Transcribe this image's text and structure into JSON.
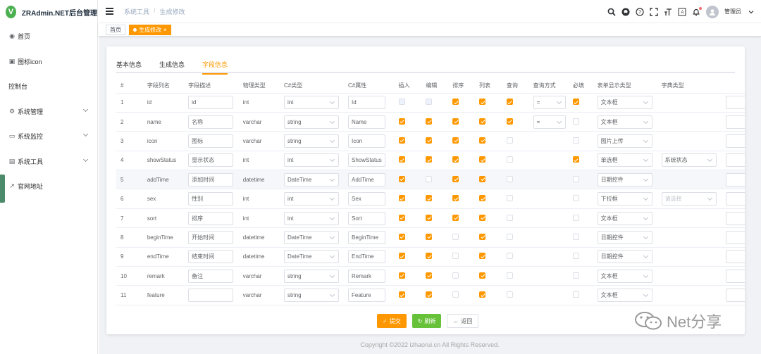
{
  "app": {
    "logo_letter": "V",
    "title": "ZRAdmin.NET后台管理"
  },
  "sidebar": {
    "items": [
      {
        "icon": "dashboard-icon",
        "glyph": "◉",
        "label": "首页",
        "has_arrow": false
      },
      {
        "icon": "image-icon",
        "glyph": "▣",
        "label": "图标icon",
        "has_arrow": false
      },
      {
        "icon": "",
        "glyph": "",
        "label": "控制台",
        "has_arrow": false
      },
      {
        "icon": "gear-icon",
        "glyph": "⚙",
        "label": "系统管理",
        "has_arrow": true
      },
      {
        "icon": "monitor-icon",
        "glyph": "▭",
        "label": "系统监控",
        "has_arrow": true
      },
      {
        "icon": "toolbox-icon",
        "glyph": "▤",
        "label": "系统工具",
        "has_arrow": true
      },
      {
        "icon": "external-link-icon",
        "glyph": "↗",
        "label": "官网地址",
        "has_arrow": false
      }
    ]
  },
  "navbar": {
    "breadcrumb": [
      "系统工具",
      "生成修改"
    ],
    "user_name": "管理员",
    "icons": [
      "search-icon",
      "github-icon",
      "help-icon",
      "fullscreen-icon",
      "font-size-icon",
      "translate-icon",
      "bell-icon"
    ]
  },
  "tags": [
    {
      "label": "首页",
      "active": false
    },
    {
      "label": "生成修改",
      "active": true
    }
  ],
  "tabs": [
    {
      "label": "基本信息",
      "active": false
    },
    {
      "label": "生成信息",
      "active": false
    },
    {
      "label": "字段信息",
      "active": true
    }
  ],
  "table": {
    "headers": [
      "#",
      "字段列名",
      "字段描述",
      "物理类型",
      "C#类型",
      "C#属性",
      "插入",
      "编辑",
      "排序",
      "列表",
      "查询",
      "查询方式",
      "必填",
      "表单显示类型",
      "字典类型",
      ""
    ],
    "rows": [
      {
        "no": "1",
        "column": "id",
        "desc": "id",
        "db_type": "int",
        "cs_type": "int",
        "cs_field": "Id",
        "insert": "dis",
        "edit": "dis",
        "sort": "on",
        "list": "on",
        "query": "on",
        "query_type": "=",
        "required": "on",
        "html_type": "文本框",
        "dict": "",
        "dict_ph": false
      },
      {
        "no": "2",
        "column": "name",
        "desc": "名称",
        "db_type": "varchar",
        "cs_type": "string",
        "cs_field": "Name",
        "insert": "on",
        "edit": "on",
        "sort": "on",
        "list": "on",
        "query": "on",
        "query_type": "=",
        "required": "off",
        "html_type": "文本框",
        "dict": "",
        "dict_ph": false
      },
      {
        "no": "3",
        "column": "icon",
        "desc": "图标",
        "db_type": "varchar",
        "cs_type": "string",
        "cs_field": "Icon",
        "insert": "on",
        "edit": "on",
        "sort": "on",
        "list": "on",
        "query": "off",
        "query_type": "",
        "required": "off",
        "html_type": "图片上传",
        "dict": "",
        "dict_ph": false
      },
      {
        "no": "4",
        "column": "showStatus",
        "desc": "显示状态",
        "db_type": "int",
        "cs_type": "int",
        "cs_field": "ShowStatus",
        "insert": "on",
        "edit": "on",
        "sort": "on",
        "list": "on",
        "query": "off",
        "query_type": "",
        "required": "on",
        "html_type": "单选框",
        "dict": "系统状态",
        "dict_ph": false
      },
      {
        "no": "5",
        "column": "addTime",
        "desc": "添加时间",
        "db_type": "datetime",
        "cs_type": "DateTime",
        "cs_field": "AddTime",
        "insert": "on",
        "edit": "off",
        "sort": "on",
        "list": "on",
        "query": "off",
        "query_type": "",
        "required": "off",
        "html_type": "日期控件",
        "dict": "",
        "dict_ph": false
      },
      {
        "no": "6",
        "column": "sex",
        "desc": "性别",
        "db_type": "int",
        "cs_type": "int",
        "cs_field": "Sex",
        "insert": "on",
        "edit": "on",
        "sort": "on",
        "list": "on",
        "query": "off",
        "query_type": "",
        "required": "off",
        "html_type": "下拉框",
        "dict": "请选择",
        "dict_ph": true
      },
      {
        "no": "7",
        "column": "sort",
        "desc": "排序",
        "db_type": "int",
        "cs_type": "int",
        "cs_field": "Sort",
        "insert": "on",
        "edit": "on",
        "sort": "on",
        "list": "on",
        "query": "off",
        "query_type": "",
        "required": "off",
        "html_type": "文本框",
        "dict": "",
        "dict_ph": false
      },
      {
        "no": "8",
        "column": "beginTime",
        "desc": "开始时间",
        "db_type": "datetime",
        "cs_type": "DateTime",
        "cs_field": "BeginTime",
        "insert": "on",
        "edit": "on",
        "sort": "off",
        "list": "on",
        "query": "off",
        "query_type": "",
        "required": "off",
        "html_type": "日期控件",
        "dict": "",
        "dict_ph": false
      },
      {
        "no": "9",
        "column": "endTime",
        "desc": "结束时间",
        "db_type": "datetime",
        "cs_type": "DateTime",
        "cs_field": "EndTime",
        "insert": "on",
        "edit": "on",
        "sort": "off",
        "list": "on",
        "query": "off",
        "query_type": "",
        "required": "off",
        "html_type": "日期控件",
        "dict": "",
        "dict_ph": false
      },
      {
        "no": "10",
        "column": "remark",
        "desc": "备注",
        "db_type": "varchar",
        "cs_type": "string",
        "cs_field": "Remark",
        "insert": "on",
        "edit": "on",
        "sort": "off",
        "list": "on",
        "query": "off",
        "query_type": "",
        "required": "off",
        "html_type": "文本框",
        "dict": "",
        "dict_ph": false
      },
      {
        "no": "11",
        "column": "feature",
        "desc": "",
        "db_type": "varchar",
        "cs_type": "string",
        "cs_field": "Feature",
        "insert": "on",
        "edit": "on",
        "sort": "off",
        "list": "on",
        "query": "off",
        "query_type": "",
        "required": "off",
        "html_type": "文本框",
        "dict": "",
        "dict_ph": false
      }
    ]
  },
  "buttons": {
    "submit": "提交",
    "refresh": "刷新",
    "back": "返回"
  },
  "footer": "Copyright ©2022 izhaorui.cn All Rights Reserved.",
  "watermark": "Net分享",
  "colors": {
    "accent": "#ff9800",
    "success": "#67c23a",
    "logo": "#4caf50"
  }
}
